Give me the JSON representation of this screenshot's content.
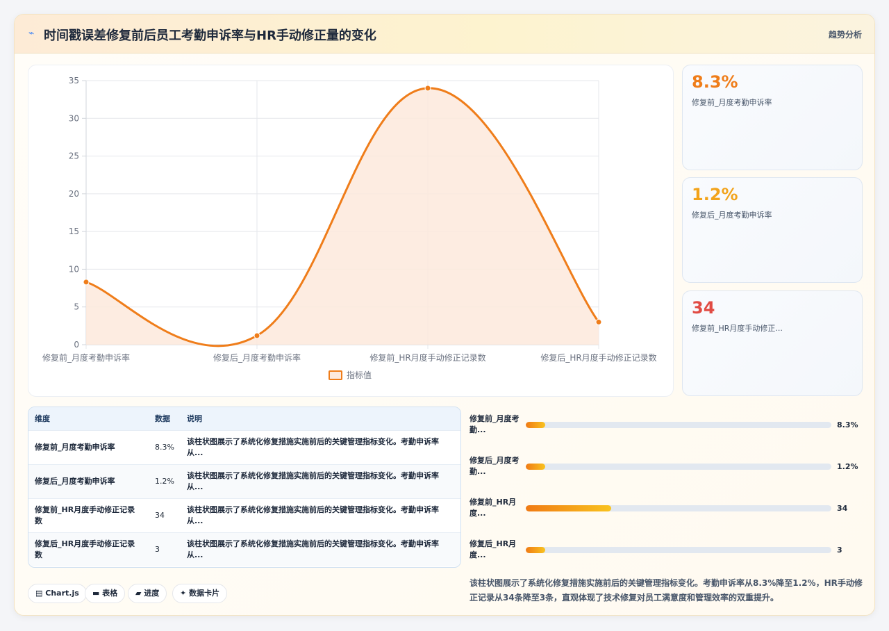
{
  "header": {
    "icon": "spark-icon",
    "title": "时间戳误差修复前后员工考勤申诉率与HR手动修正量的变化",
    "tag": "趋势分析"
  },
  "colors": {
    "accent": "#ef7d1a",
    "fill": "#fde9dc",
    "stat1": "#ef7d1a",
    "stat2": "#f2a31b",
    "stat3": "#e14b44"
  },
  "chart_data": {
    "type": "area",
    "categories": [
      "修复前_月度考勤申诉率",
      "修复后_月度考勤申诉率",
      "修复前_HR月度手动修正记录数",
      "修复后_HR月度手动修正记录数"
    ],
    "series": [
      {
        "name": "指标值",
        "values": [
          8.3,
          1.2,
          34,
          3
        ]
      }
    ],
    "ylim": [
      0,
      35
    ],
    "yticks": [
      0,
      5,
      10,
      15,
      20,
      25,
      30,
      35
    ],
    "grid": true,
    "legend": "bottom"
  },
  "stats": [
    {
      "value": "8.3%",
      "label": "修复前_月度考勤申诉率"
    },
    {
      "value": "1.2%",
      "label": "修复后_月度考勤申诉率"
    },
    {
      "value": "34",
      "label": "修复前_HR月度手动修正..."
    }
  ],
  "table": {
    "headers": [
      "维度",
      "数据",
      "说明"
    ],
    "rows": [
      {
        "dim": "修复前_月度考勤申诉率",
        "val": "8.3%",
        "desc": "该柱状图展示了系统化修复措施实施前后的关键管理指标变化。考勤申诉率从..."
      },
      {
        "dim": "修复后_月度考勤申诉率",
        "val": "1.2%",
        "desc": "该柱状图展示了系统化修复措施实施前后的关键管理指标变化。考勤申诉率从..."
      },
      {
        "dim": "修复前_HR月度手动修正记录数",
        "val": "34",
        "desc": "该柱状图展示了系统化修复措施实施前后的关键管理指标变化。考勤申诉率从..."
      },
      {
        "dim": "修复后_HR月度手动修正记录数",
        "val": "3",
        "desc": "该柱状图展示了系统化修复措施实施前后的关键管理指标变化。考勤申诉率从..."
      }
    ]
  },
  "progress": [
    {
      "label": "修复前_月度考勤...",
      "value": "8.3%",
      "fraction": 0.064
    },
    {
      "label": "修复后_月度考勤...",
      "value": "1.2%",
      "fraction": 0.064
    },
    {
      "label": "修复前_HR月度...",
      "value": "34",
      "fraction": 0.28
    },
    {
      "label": "修复后_HR月度...",
      "value": "3",
      "fraction": 0.064
    }
  ],
  "summary": "该柱状图展示了系统化修复措施实施前后的关键管理指标变化。考勤申诉率从8.3%降至1.2%，HR手动修正记录从34条降至3条，直观体现了技术修复对员工满意度和管理效率的双重提升。",
  "chips": [
    {
      "icon": "chart-icon",
      "label": "Chart.js"
    },
    {
      "icon": "table-icon",
      "label": "表格"
    },
    {
      "icon": "progress-icon",
      "label": "进度"
    },
    {
      "icon": "sparkle-icon",
      "label": "数据卡片"
    }
  ]
}
